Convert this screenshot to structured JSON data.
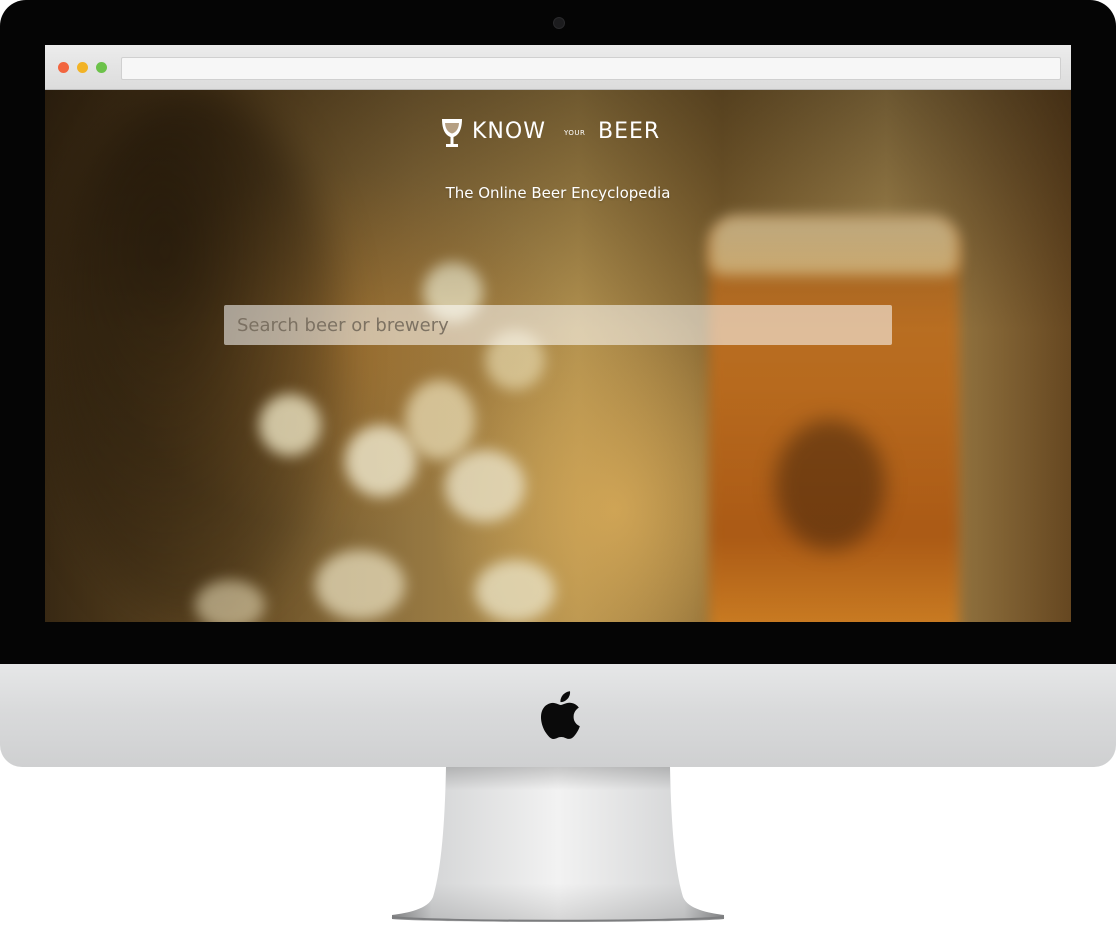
{
  "site": {
    "logo_know": "KNOW",
    "logo_your": "YOUR",
    "logo_beer": "BEER",
    "logo_icon": "beer-glass-icon",
    "tagline": "The Online Beer Encyclopedia"
  },
  "search": {
    "placeholder": "Search beer or brewery",
    "value": ""
  },
  "browser": {
    "window_controls": [
      "close",
      "minimize",
      "maximize"
    ],
    "address": ""
  },
  "device": {
    "brand_icon": "apple-logo-icon"
  },
  "colors": {
    "close": "#f2653f",
    "minimize": "#f2b326",
    "maximize": "#6cc24a",
    "text": "#ffffff"
  }
}
